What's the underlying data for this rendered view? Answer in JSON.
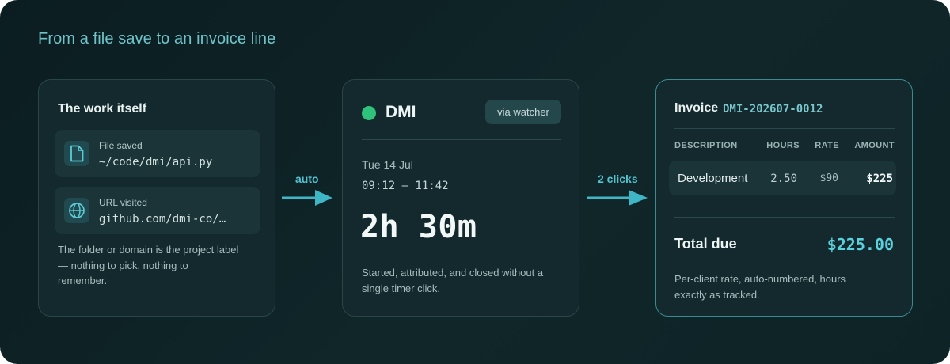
{
  "headline": "From a file save to an invoice line",
  "colors": {
    "background": "#0e2326",
    "card": "#13292d",
    "accent": "#54c4d2",
    "status_active": "#2fc27a",
    "highlight_border": "#3a8c92"
  },
  "work_card": {
    "title": "The work itself",
    "items": [
      {
        "icon": "file-icon",
        "label": "File saved",
        "value": "~/code/dmi/api.py"
      },
      {
        "icon": "globe-icon",
        "label": "URL visited",
        "value": "github.com/dmi-co/…"
      }
    ],
    "note": "The folder or domain is the project label — nothing to pick, nothing to remember."
  },
  "arrows": [
    {
      "label": "auto"
    },
    {
      "label": "2 clicks"
    }
  ],
  "entry_card": {
    "client": "DMI",
    "status_icon": "status-dot-icon",
    "badge": "via watcher",
    "date": "Tue 14 Jul",
    "time_range": "09:12 – 11:42",
    "duration": "2h 30m",
    "note": "Started, attributed, and closed without a single timer click."
  },
  "invoice_card": {
    "title": "Invoice",
    "number": "DMI-202607-0012",
    "columns": [
      "DESCRIPTION",
      "HOURS",
      "RATE",
      "AMOUNT"
    ],
    "rows": [
      {
        "description": "Development",
        "hours": "2.50",
        "rate": "$90",
        "amount": "$225"
      }
    ],
    "total_label": "Total due",
    "total_value": "$225.00",
    "note": "Per-client rate, auto-numbered, hours exactly as tracked."
  }
}
